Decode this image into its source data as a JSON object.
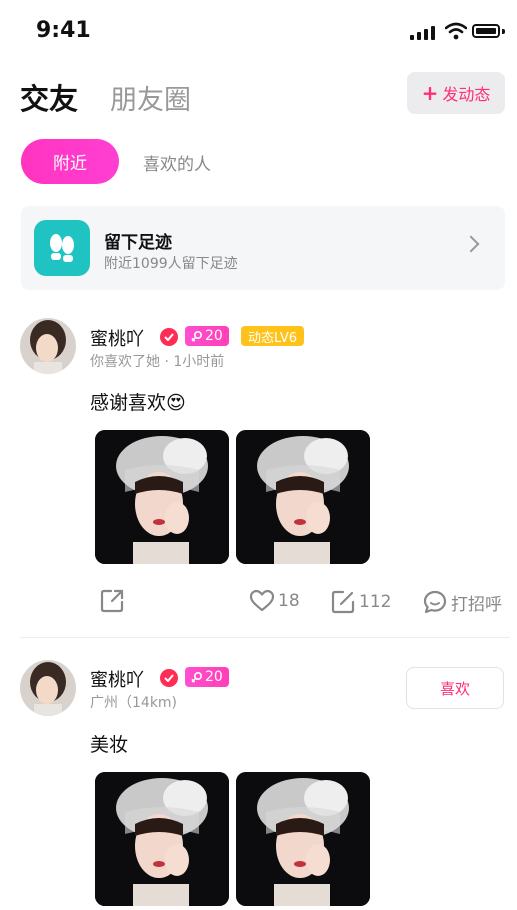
{
  "status_bar": {
    "time": "9:41"
  },
  "header": {
    "tab_active": "交友",
    "tab_inactive": "朋友圈",
    "post_button": "发动态"
  },
  "filters": {
    "nearby": "附近",
    "liked": "喜欢的人"
  },
  "footprint": {
    "title": "留下足迹",
    "subtitle": "附近1099人留下足迹"
  },
  "posts": [
    {
      "name": "蜜桃吖",
      "age": "20",
      "level": "动态LV6",
      "meta": "你喜欢了她 · 1小时前",
      "caption": "感谢喜欢😍",
      "likes": "18",
      "comments": "112",
      "greet": "打招呼"
    },
    {
      "name": "蜜桃吖",
      "age": "20",
      "meta": "广州（14km)",
      "caption": "美妆",
      "like_button": "喜欢"
    }
  ],
  "colors": {
    "accent": "#ff2d7a",
    "chip": "#ff34bf",
    "teal": "#1fc3c1",
    "gold": "#ffc21a"
  },
  "icons": [
    "share-icon",
    "heart-icon",
    "comment-edit-icon",
    "chat-bubble-icon",
    "footprints-icon",
    "chevron-right-icon",
    "verified-badge-icon",
    "female-icon"
  ]
}
